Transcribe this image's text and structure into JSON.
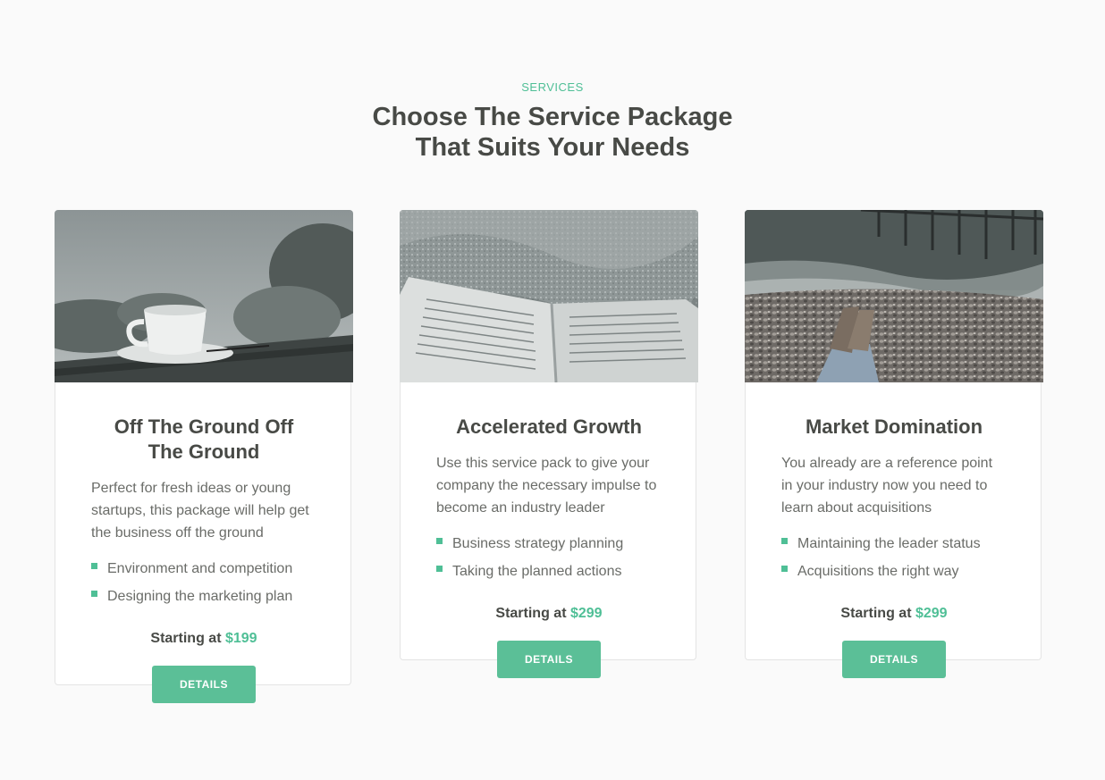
{
  "header": {
    "eyebrow": "SERVICES",
    "title_line1": "Choose The Service Package",
    "title_line2": "That Suits Your Needs"
  },
  "colors": {
    "accent": "#4fbf96",
    "button": "#5bbf97",
    "heading": "#484a46",
    "body_text": "#6a6c68",
    "background": "#fafafa"
  },
  "cards": [
    {
      "image": "coffee-cup-photo",
      "title_line1": "Off The Ground Off",
      "title_line2": "The Ground",
      "description": "Perfect for fresh ideas or young startups, this package will help get the business off the ground",
      "features": [
        "Environment and competition",
        "Designing the marketing plan"
      ],
      "price_prefix": "Starting at",
      "price": "$199",
      "button_label": "DETAILS"
    },
    {
      "image": "open-book-on-sand-photo",
      "title": "Accelerated Growth",
      "description": "Use this service pack to give your company the necessary impulse to become an industry leader",
      "features": [
        "Business strategy planning",
        "Taking the planned actions"
      ],
      "price_prefix": "Starting at",
      "price": "$299",
      "button_label": "DETAILS"
    },
    {
      "image": "feet-on-pebble-beach-photo",
      "title": "Market Domination",
      "description": "You already are a reference point in your industry now you need to learn about acquisitions",
      "features": [
        "Maintaining the leader status",
        "Acquisitions the right way"
      ],
      "price_prefix": "Starting at",
      "price": "$299",
      "button_label": "DETAILS"
    }
  ]
}
